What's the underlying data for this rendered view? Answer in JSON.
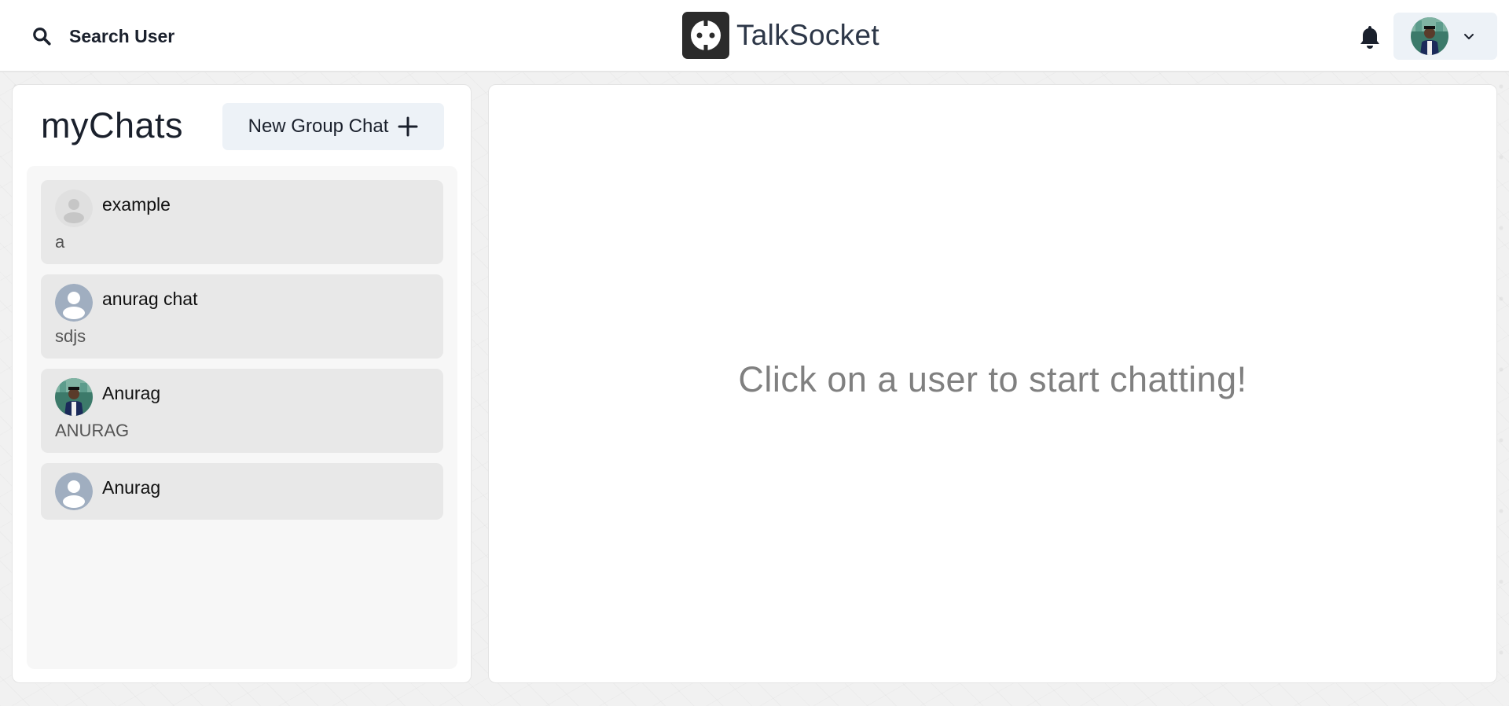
{
  "header": {
    "search_label": "Search User",
    "brand_name": "TalkSocket"
  },
  "chats": {
    "title": "myChats",
    "new_group_label": "New Group Chat",
    "items": [
      {
        "name": "example",
        "preview": "a",
        "avatar": "default-avatar-light"
      },
      {
        "name": "anurag chat",
        "preview": "sdjs",
        "avatar": "default-avatar"
      },
      {
        "name": "Anurag",
        "preview": "ANURAG",
        "avatar": "user-photo"
      },
      {
        "name": "Anurag",
        "preview": "",
        "avatar": "default-avatar"
      }
    ]
  },
  "main": {
    "empty_message": "Click on a user to start chatting!"
  },
  "icons": {
    "search": "search-icon",
    "logo": "socket-logo-icon",
    "bell": "bell-icon",
    "chevron": "chevron-down-icon",
    "plus": "plus-icon"
  },
  "colors": {
    "topbar_bg": "#ffffff",
    "button_bg": "#edf2f7",
    "chat_item_bg": "#e8e8e8",
    "chat_list_bg": "#f7f7f7",
    "default_avatar": "#a0aec0",
    "text_dark": "#1a202c",
    "empty_message": "#808080"
  }
}
